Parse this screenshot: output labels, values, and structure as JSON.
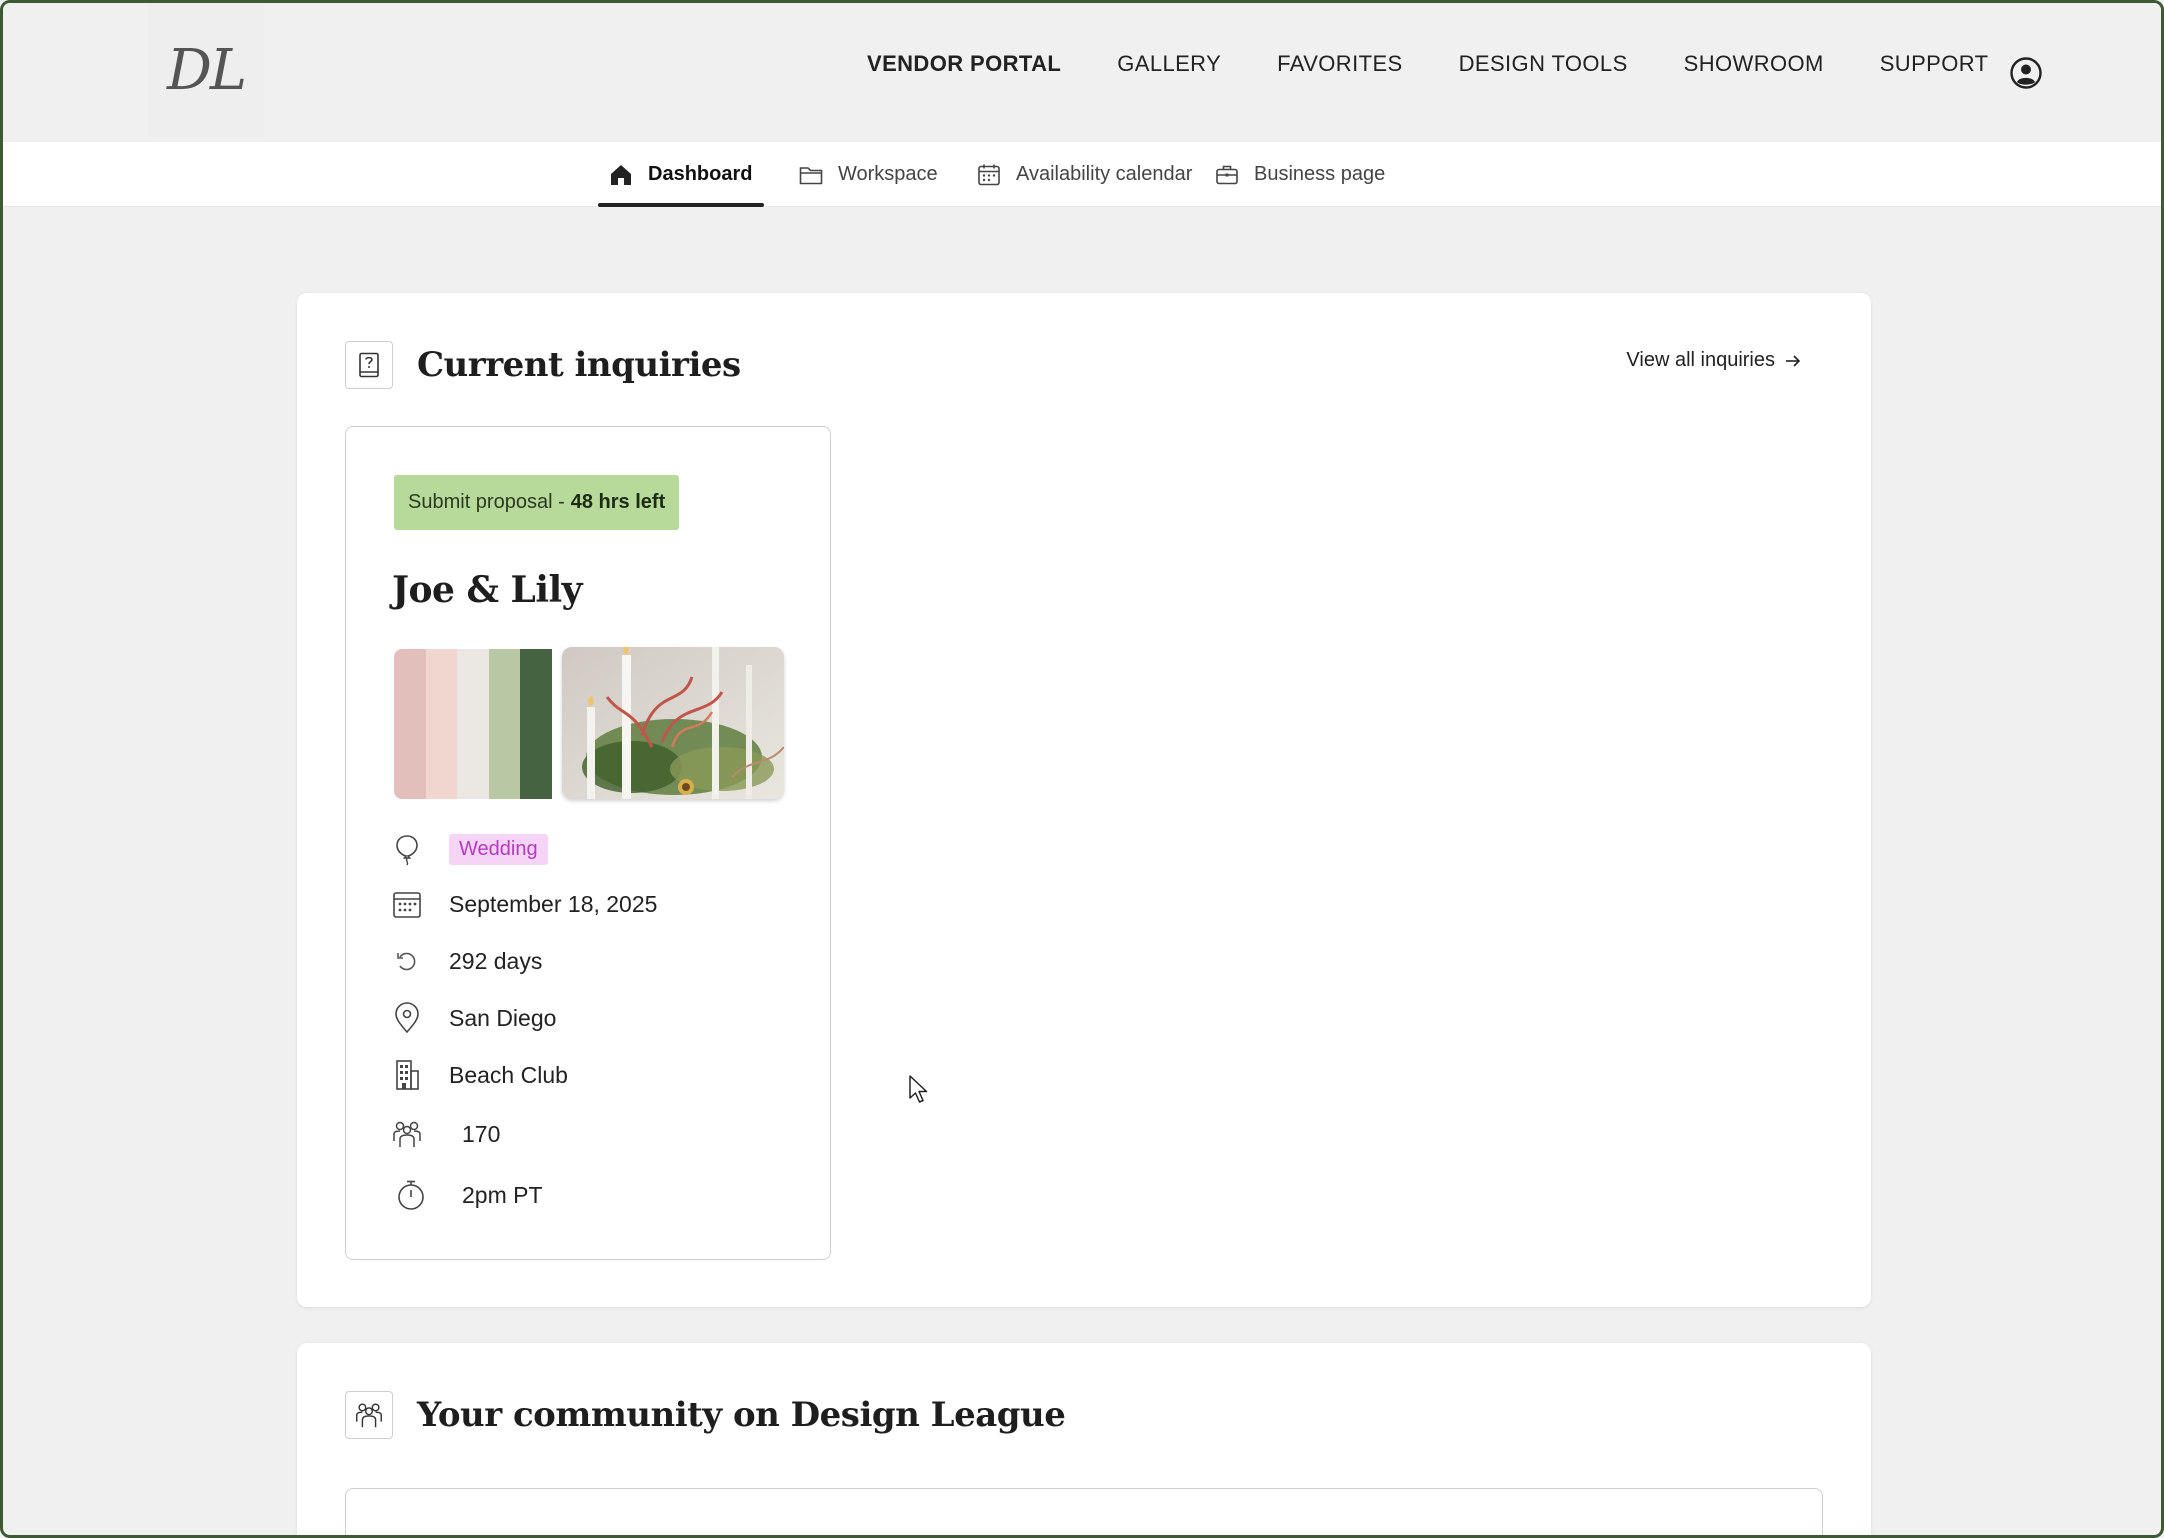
{
  "app": {
    "logo_text": "DL"
  },
  "nav": {
    "items": [
      {
        "label": "VENDOR PORTAL",
        "active": true
      },
      {
        "label": "GALLERY",
        "active": false
      },
      {
        "label": "FAVORITES",
        "active": false
      },
      {
        "label": "DESIGN TOOLS",
        "active": false
      },
      {
        "label": "SHOWROOM",
        "active": false
      },
      {
        "label": "SUPPORT",
        "active": false
      }
    ],
    "account_icon": "user-circle-icon"
  },
  "subnav": {
    "tabs": [
      {
        "label": "Dashboard",
        "icon": "home-icon",
        "active": true
      },
      {
        "label": "Workspace",
        "icon": "folder-icon",
        "active": false
      },
      {
        "label": "Availability calendar",
        "icon": "calendar-icon",
        "active": false
      },
      {
        "label": "Business page",
        "icon": "briefcase-icon",
        "active": false
      }
    ]
  },
  "inquiries": {
    "title": "Current inquiries",
    "view_all_label": "View all inquiries",
    "card": {
      "badge_prefix": "Submit proposal -",
      "badge_emphasis": "48 hrs left",
      "couple": "Joe & Lily",
      "palette": [
        "#e3bfbb",
        "#f1d5cf",
        "#ebe7e2",
        "#b8c7a4",
        "#456241"
      ],
      "event_type": "Wedding",
      "date": "September 18, 2025",
      "countdown": "292 days",
      "location": "San Diego",
      "venue": "Beach Club",
      "guests": "170",
      "time": "2pm PT"
    }
  },
  "community": {
    "title": "Your community on Design League"
  },
  "colors": {
    "badge": "#b7d99a",
    "tag_bg": "#f5d5f6",
    "tag_text": "#b53ac0",
    "frame": "#3d5a33"
  }
}
